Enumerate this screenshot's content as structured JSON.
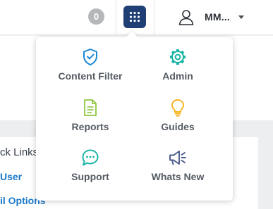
{
  "header": {
    "notification_count": "0",
    "apps_icon": "grid-icon",
    "user_icon": "user-icon",
    "user_name": "MM...",
    "caret_icon": "caret-down-icon"
  },
  "background": {
    "quick_links_title": "ck Links",
    "links": [
      "User",
      "il Options"
    ]
  },
  "apps_menu": {
    "items": [
      {
        "label": "Content Filter",
        "icon": "shield-check-icon",
        "color": "#1a8ad4"
      },
      {
        "label": "Admin",
        "icon": "gear-icon",
        "color": "#17b3a3"
      },
      {
        "label": "Reports",
        "icon": "document-icon",
        "color": "#8cc63f"
      },
      {
        "label": "Guides",
        "icon": "lightbulb-icon",
        "color": "#f5b21b"
      },
      {
        "label": "Support",
        "icon": "chat-bubble-icon",
        "color": "#17b3a3"
      },
      {
        "label": "Whats New",
        "icon": "megaphone-icon",
        "color": "#4a5a8c"
      }
    ]
  },
  "colors": {
    "apps_button": "#1f3f75",
    "link": "#1a79c9",
    "badge": "#b5b7ba"
  }
}
